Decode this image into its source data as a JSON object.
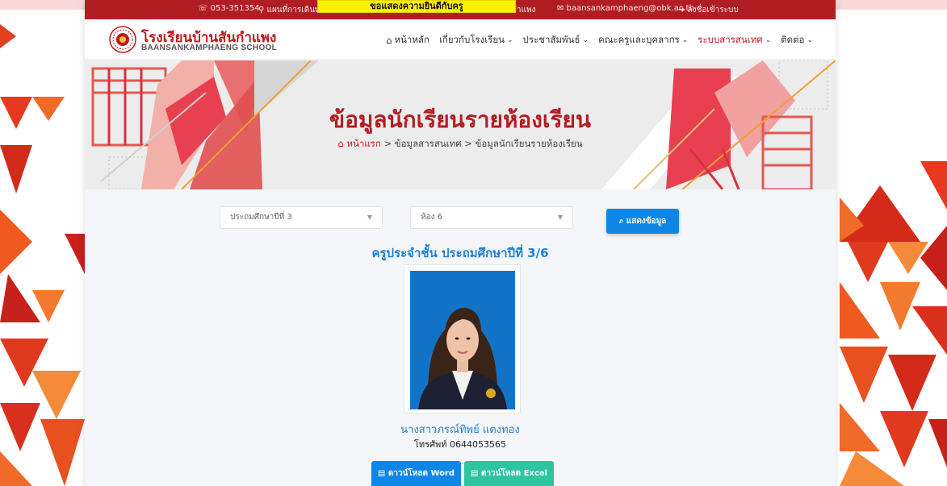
{
  "topbar": {
    "phone": "☏ 053-351354",
    "address": "⚲ แผนที่การเดินทาง",
    "facebook": "โรงเรียนบ้านสันกำแพง",
    "email": "✉ baansankamphaeng@obk.ac.th",
    "login": "➜ ลงชื่อเข้าระบบ"
  },
  "notice": {
    "text": "ขอแสดงความยินดีกับครู"
  },
  "header": {
    "school_name": "โรงเรียนบ้านสันกำแพง",
    "school_name_en": "BAANSANKAMPHAENG SCHOOL"
  },
  "nav": {
    "items": [
      {
        "label": "หน้าหลัก",
        "icon": "home-icon",
        "dropdown": false,
        "active": false
      },
      {
        "label": "เกี่ยวกับโรงเรียน",
        "dropdown": true,
        "active": false
      },
      {
        "label": "ประชาสัมพันธ์",
        "dropdown": true,
        "active": false
      },
      {
        "label": "คณะครูและบุคลากร",
        "dropdown": true,
        "active": false
      },
      {
        "label": "ระบบสารสนเทศ",
        "dropdown": true,
        "active": true
      },
      {
        "label": "ติดต่อ",
        "dropdown": true,
        "active": false
      }
    ]
  },
  "banner": {
    "title": "ข้อมูลนักเรียนรายห้องเรียน",
    "breadcrumb": {
      "home": "หน้าแรก",
      "sep": ">",
      "section": "ข้อมูลสารสนเทศ",
      "current": "ข้อมูลนักเรียนรายห้องเรียน"
    }
  },
  "filters": {
    "grade": {
      "value": "ประถมศึกษาปีที่ 3"
    },
    "room": {
      "value": "ห้อง 6"
    },
    "show_button": "แสดงข้อมูล"
  },
  "teacher": {
    "heading": "ครูประจำชั้น ประถมศึกษาปีที่ 3/6",
    "name": "นางสาวภรณ์ทิพย์ แตงทอง",
    "phone": "โทรศัพท์ 0644053565"
  },
  "downloads": {
    "word": "ดาวน์โหลด Word",
    "excel": "ดาวน์โหลด Excel"
  },
  "colors": {
    "brand_red": "#b01e23",
    "accent_blue": "#0d86e6",
    "accent_green": "#2ec4a0",
    "link_blue": "#1f7fd1"
  }
}
